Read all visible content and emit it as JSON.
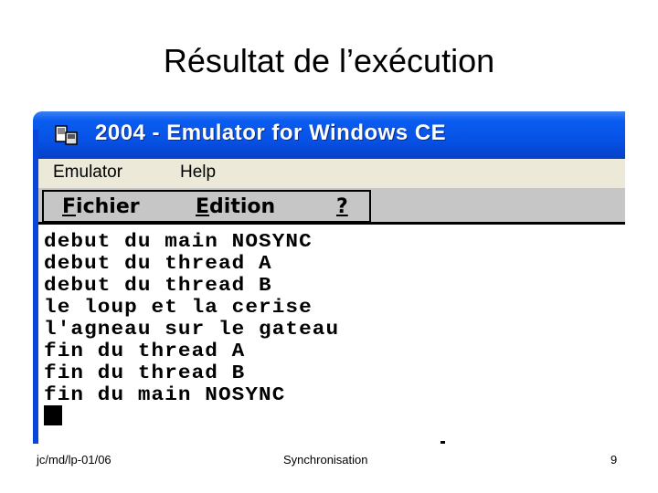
{
  "slide": {
    "title": "Résultat de l’exécution",
    "footer_left": "jc/md/lp-01/06",
    "footer_center": "Synchronisation",
    "page_number": "9"
  },
  "window": {
    "title": "2004 - Emulator for Windows CE",
    "icon": "emulator-app-icon",
    "menu": [
      "Emulator",
      "Help"
    ]
  },
  "ce_app": {
    "menu": [
      {
        "accel": "F",
        "rest": "ichier"
      },
      {
        "accel": "E",
        "rest": "dition"
      },
      {
        "accel": "?",
        "rest": ""
      }
    ],
    "console_lines": [
      "debut du main NOSYNC",
      "debut du thread A",
      "debut du thread B",
      "le loup et la cerise",
      "l'agneau sur le gateau",
      "fin du thread A",
      "fin du thread B",
      "fin du main NOSYNC"
    ]
  },
  "colors": {
    "titlebar": "#0752e6",
    "menubar": "#ece9d8",
    "ce_menubar": "#c6c6c6"
  }
}
